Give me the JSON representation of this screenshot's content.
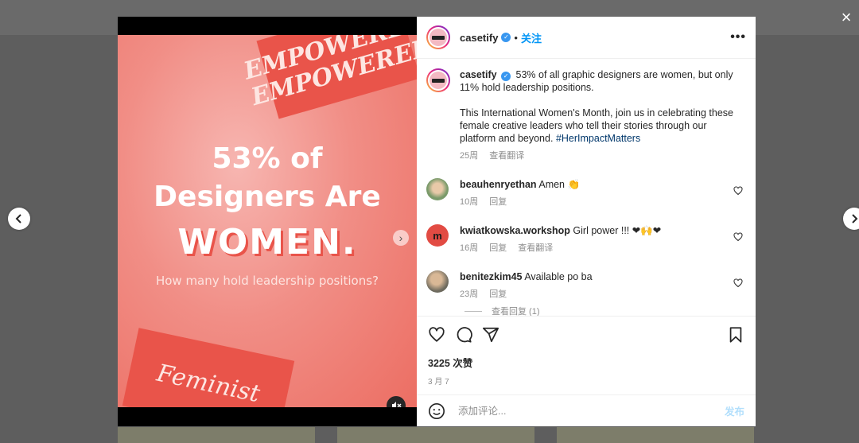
{
  "post": {
    "image": {
      "line1": "53% of",
      "line2": "Designers Are",
      "line3": "WOMEN.",
      "line4": "How many hold leadership positions?",
      "sticker_top": "EMPOWERED EMPOWERED",
      "sticker_bottom": "Feminist"
    },
    "username": "casetify",
    "follow_label": "关注",
    "separator": "•",
    "more_label": "•••",
    "caption_user": "casetify",
    "caption_line1": "53% of all graphic designers are women, but only 11% hold leadership positions.",
    "caption_line2": "This International Women's Month, join us in celebrating these female creative leaders who tell their stories through our platform and beyond.",
    "caption_hashtag": "#HerImpactMatters",
    "caption_time": "25周",
    "caption_translate": "查看翻译",
    "comments": [
      {
        "user": "beauhenryethan",
        "text": "Amen 👏",
        "time": "10周",
        "reply": "回复"
      },
      {
        "user": "kwiatkowska.workshop",
        "text": "Girl power !!! ❤🙌❤",
        "time": "16周",
        "reply": "回复",
        "translate": "查看翻译"
      },
      {
        "user": "benitezkim45",
        "text": "Available po ba",
        "time": "23周",
        "reply": "回复"
      }
    ],
    "view_replies": "查看回复 (1)",
    "likes": "3225 次赞",
    "date": "3 月 7",
    "add_comment_placeholder": "添加评论...",
    "post_label": "发布",
    "close_icon": "×"
  }
}
